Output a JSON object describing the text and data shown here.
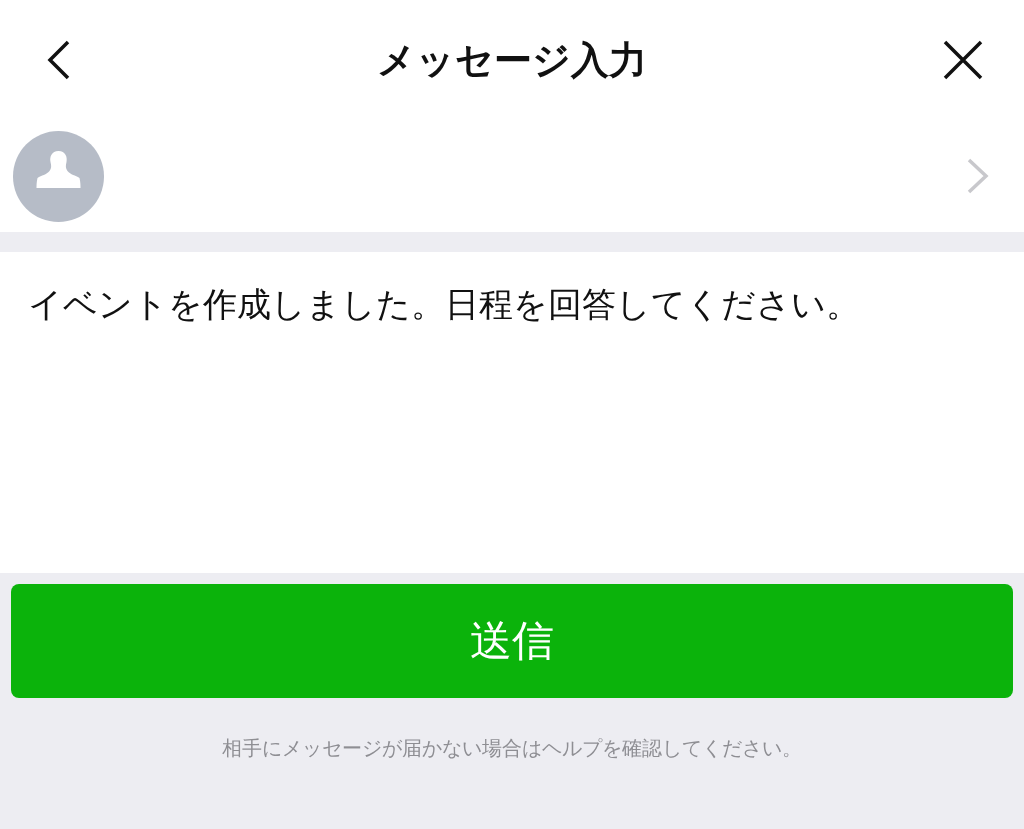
{
  "header": {
    "title": "メッセージ入力"
  },
  "message": {
    "value": "イベントを作成しました。日程を回答してください。"
  },
  "send_button": {
    "label": "送信"
  },
  "footer_note": "相手にメッセージが届かない場合はヘルプを確認してください。"
}
